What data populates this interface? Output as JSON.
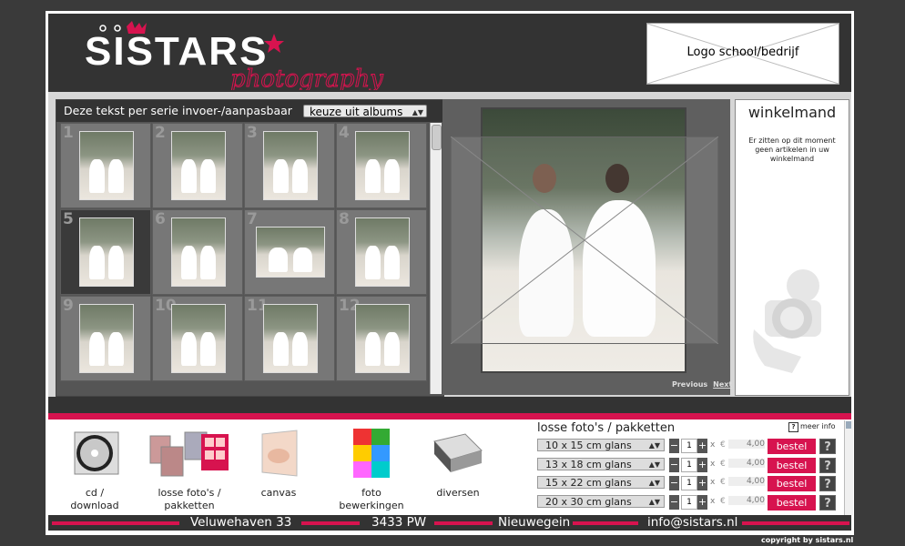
{
  "header": {
    "brand_name": "SISTARS",
    "brand_tagline": "photography",
    "logo_placeholder": "Logo school/bedrijf"
  },
  "gallery": {
    "title": "Deze tekst per serie invoer-/aanpasbaar",
    "album_select": "keuze uit albums",
    "thumbnails": [
      {
        "num": "1",
        "orientation": "portrait"
      },
      {
        "num": "2",
        "orientation": "portrait"
      },
      {
        "num": "3",
        "orientation": "portrait"
      },
      {
        "num": "4",
        "orientation": "portrait"
      },
      {
        "num": "5",
        "orientation": "portrait",
        "selected": true
      },
      {
        "num": "6",
        "orientation": "portrait"
      },
      {
        "num": "7",
        "orientation": "landscape"
      },
      {
        "num": "8",
        "orientation": "portrait"
      },
      {
        "num": "9",
        "orientation": "portrait"
      },
      {
        "num": "10",
        "orientation": "portrait"
      },
      {
        "num": "11",
        "orientation": "portrait"
      },
      {
        "num": "12",
        "orientation": "portrait"
      }
    ]
  },
  "viewer": {
    "previous": "Previous",
    "next": "Next"
  },
  "cart": {
    "title": "winkelmand",
    "message": "Er zitten op dit moment geen artikelen in uw winkelmand"
  },
  "products": [
    {
      "label_line1": "cd /",
      "label_line2": "download",
      "icon": "cd-icon"
    },
    {
      "label_line1": "losse foto's /",
      "label_line2": "pakketten",
      "icon": "photos-icon"
    },
    {
      "label_line1": "canvas",
      "label_line2": "",
      "icon": "canvas-icon"
    },
    {
      "label_line1": "foto",
      "label_line2": "bewerkingen",
      "icon": "pop-art-icon"
    },
    {
      "label_line1": "diversen",
      "label_line2": "",
      "icon": "album-icon"
    }
  ],
  "pricing": {
    "title": "losse foto's / pakketten",
    "more_info": "meer info",
    "rows": [
      {
        "size": "10 x 15 cm glans",
        "qty": "1",
        "times": "x",
        "currency": "€",
        "price": "4,00",
        "order": "bestel",
        "help": "?"
      },
      {
        "size": "13 x 18 cm glans",
        "qty": "1",
        "times": "x",
        "currency": "€",
        "price": "4,00",
        "order": "bestel",
        "help": "?"
      },
      {
        "size": "15 x 22 cm glans",
        "qty": "1",
        "times": "x",
        "currency": "€",
        "price": "4,00",
        "order": "bestel",
        "help": "?"
      },
      {
        "size": "20 x 30 cm glans",
        "qty": "1",
        "times": "x",
        "currency": "€",
        "price": "4,00",
        "order": "bestel",
        "help": "?"
      }
    ]
  },
  "footer": {
    "street": "Veluwehaven 33",
    "postcode": "3433 PW",
    "city": "Nieuwegein",
    "email": "info@sistars.nl"
  },
  "copyright": "copyright by sistars.nl",
  "colors": {
    "brand_pink": "#d7134f",
    "dark": "#333333",
    "page_bg": "#3a3a3a"
  }
}
